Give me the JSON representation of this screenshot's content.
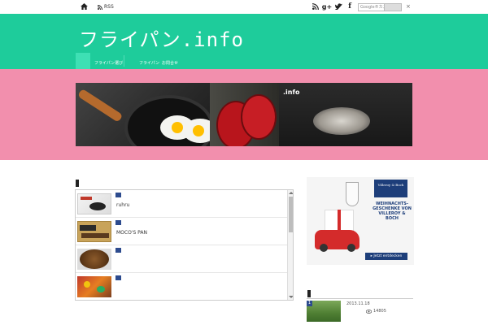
{
  "topbar": {
    "rss_label": "RSS",
    "search_placeholder": "Google®カスタ",
    "close_label": "×"
  },
  "header": {
    "site_title": "フライパン.info",
    "nav": [
      "フライパン選び",
      "フライパン",
      "お問合せ"
    ]
  },
  "banner": {
    "label": ".info"
  },
  "articles": [
    {
      "title": "ruhru"
    },
    {
      "title": "MOCO'S PAN"
    },
    {
      "title": ""
    },
    {
      "title": ""
    }
  ],
  "ad": {
    "brand": "Villeroy & Boch",
    "headline": "WEIHNACHTS-GESCHENKE VON VILLEROY & BOCH",
    "cta": "▸ Jetzt entdecken"
  },
  "ranking": {
    "number": "1",
    "date": "2013.11.18",
    "views": "14805"
  },
  "colors": {
    "header": "#1ecc9b",
    "band": "#f28fad",
    "badge": "#2d4b8e"
  }
}
